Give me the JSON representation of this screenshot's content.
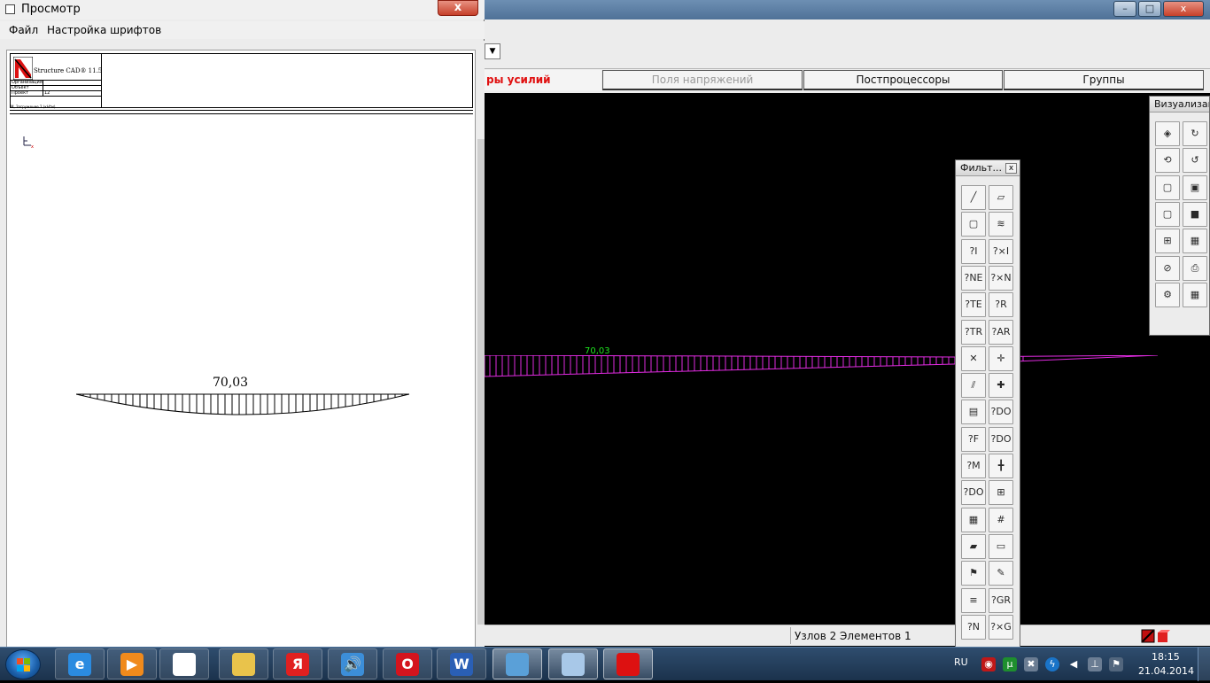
{
  "preview_window": {
    "title": "Просмотр",
    "close_label": "x",
    "menu": [
      "Файл",
      "Настройка шрифтов"
    ],
    "sheet": {
      "brand": "Structure CAD® 11.5",
      "rows": [
        {
          "label": "Организация",
          "value": ""
        },
        {
          "label": "Объект",
          "value": ""
        },
        {
          "label": "Проект",
          "value": "12"
        }
      ],
      "caption": "M, Загружение 2   (кН*м)",
      "diagram_value": "70,03"
    }
  },
  "main_window": {
    "title": "",
    "controls": {
      "minimize": "–",
      "maximize": "□",
      "close": "x"
    },
    "combo_arrow": "▼",
    "tabs": [
      {
        "label": "ры усилий",
        "active": true
      },
      {
        "label": "Поля напряжений",
        "active": false
      },
      {
        "label": "Постпроцессоры",
        "active": false
      },
      {
        "label": "Группы",
        "active": false
      }
    ],
    "canvas_value": "70,03",
    "status_text": "Узлов 2 Элементов 1"
  },
  "filter_panel": {
    "title": "Фильт...",
    "close_label": "x",
    "buttons": [
      "pencil",
      "eraser",
      "cube",
      "spring",
      "q-i",
      "q-x-i",
      "q-ne",
      "q-x-nj",
      "q-te",
      "q-r",
      "q-triangle",
      "q-arrows",
      "cross-node",
      "cross-arrows",
      "hatch",
      "cross-arrow",
      "load-grid",
      "q-down",
      "q-f",
      "q-dots",
      "q-m",
      "cross-bars",
      "q-dotgrid",
      "grid-arrow",
      "table-grid",
      "hash-grid",
      "eraser2",
      "plate",
      "green-flag",
      "brush",
      "stack",
      "q-grid",
      "q-n",
      "q-x-g"
    ]
  },
  "viz_panel": {
    "title": "Визуализация",
    "buttons": [
      "view-3d",
      "rotate-x",
      "rotate-z",
      "rotate-y",
      "box-front",
      "box-side",
      "cube-blue",
      "cube-cyan",
      "fragment",
      "frame-3d",
      "zoom-off",
      "printer",
      "gear-square",
      "red-grid"
    ]
  },
  "taskbar": {
    "apps": [
      {
        "name": "internet-explorer",
        "glyph": "e"
      },
      {
        "name": "media-player",
        "glyph": "▶"
      },
      {
        "name": "blank-document",
        "glyph": ""
      },
      {
        "name": "file-explorer",
        "glyph": ""
      },
      {
        "name": "yandex",
        "glyph": "Я"
      },
      {
        "name": "sound",
        "glyph": "🔊"
      },
      {
        "name": "opera",
        "glyph": "O"
      },
      {
        "name": "word",
        "glyph": "W"
      },
      {
        "name": "remote-desktop",
        "glyph": ""
      },
      {
        "name": "scad-preview",
        "glyph": ""
      },
      {
        "name": "scad",
        "glyph": ""
      }
    ],
    "language": "RU",
    "time": "18:15",
    "date": "21.04.2014"
  },
  "colors": {
    "canvas_bg": "#000000",
    "diagram_magenta": "#e12be1",
    "value_green": "#1ee51e",
    "active_tab_red": "#e01010"
  }
}
